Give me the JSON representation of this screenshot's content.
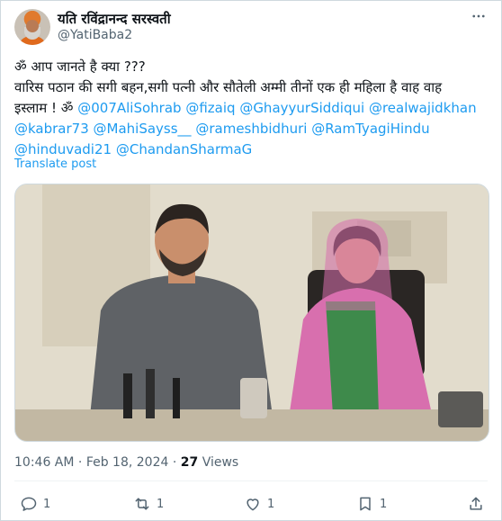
{
  "author": {
    "name": "यति रविंद्रानन्द सरस्वती",
    "handle": "@YatiBaba2"
  },
  "tweet": {
    "line1": "ॐ आप जानते है क्या ???",
    "line2": "वारिस पठान की सगी बहन,सगी पत्नी और सौतेली अम्मी तीनों एक ही महिला है वाह वाह",
    "line3_prefix": "इस्लाम ! ॐ ",
    "mentions": [
      "@007AliSohrab",
      "@fizaiq",
      "@GhayyurSiddiqui",
      "@realwajidkhan",
      "@kabrar73",
      "@MahiSayss__",
      "@rameshbidhuri",
      "@RamTyagiHindu",
      "@hinduvadi21",
      "@ChandanSharmaG"
    ],
    "translate_label": "Translate post"
  },
  "meta": {
    "time": "10:46 AM",
    "sep": " · ",
    "date": "Feb 18, 2024",
    "views_count": "27",
    "views_label": " Views"
  },
  "actions": {
    "reply_count": "1",
    "retweet_count": "1",
    "like_count": "1",
    "bookmark_count": "1"
  },
  "colors": {
    "accent": "#1d9bf0",
    "muted": "#536471",
    "text": "#0f1419",
    "robe_pink": "#d86fae",
    "kurta_gray": "#5f6266"
  }
}
